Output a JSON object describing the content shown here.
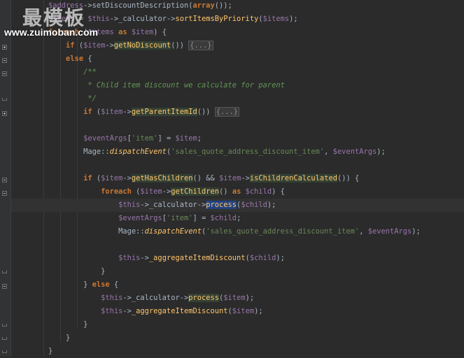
{
  "editor": {
    "lines": [
      [
        {
          "t": "    $",
          "c": "var"
        },
        {
          "t": "address",
          "c": "var"
        },
        {
          "t": "->setDiscountDescription("
        },
        {
          "t": "array",
          "c": "kw"
        },
        {
          "t": "());"
        }
      ],
      [
        {
          "t": "    $"
        },
        {
          "t": "items",
          "c": "var"
        },
        {
          "t": " = "
        },
        {
          "t": "$this",
          "c": "var"
        },
        {
          "t": "->_calculator->"
        },
        {
          "t": "sortItemsByPriority",
          "c": "fn"
        },
        {
          "t": "("
        },
        {
          "t": "$items",
          "c": "var"
        },
        {
          "t": ");"
        }
      ],
      [
        {
          "t": "    foreach ",
          "c": "kw"
        },
        {
          "t": "("
        },
        {
          "t": "$items",
          "c": "var"
        },
        {
          "t": " as ",
          "c": "kw"
        },
        {
          "t": "$item",
          "c": "var"
        },
        {
          "t": ") {"
        }
      ],
      [
        {
          "t": "        if ",
          "c": "kw"
        },
        {
          "t": "("
        },
        {
          "t": "$item",
          "c": "var"
        },
        {
          "t": "->"
        },
        {
          "t": "getNoDiscount",
          "c": "fn hl"
        },
        {
          "t": "()) "
        },
        {
          "t": "{...}",
          "c": "foldtag"
        }
      ],
      [
        {
          "t": "        else ",
          "c": "kw"
        },
        {
          "t": "{"
        }
      ],
      [
        {
          "t": "            /**",
          "c": "cmt"
        }
      ],
      [
        {
          "t": "             * Child item discount we calculate for parent",
          "c": "cmt"
        }
      ],
      [
        {
          "t": "             */",
          "c": "cmt"
        }
      ],
      [
        {
          "t": "            if ",
          "c": "kw"
        },
        {
          "t": "("
        },
        {
          "t": "$item",
          "c": "var"
        },
        {
          "t": "->"
        },
        {
          "t": "getParentItemId",
          "c": "fn hl"
        },
        {
          "t": "()) "
        },
        {
          "t": "{...}",
          "c": "foldtag"
        }
      ],
      [
        {
          "t": ""
        }
      ],
      [
        {
          "t": "            "
        },
        {
          "t": "$eventArgs",
          "c": "var"
        },
        {
          "t": "["
        },
        {
          "t": "'item'",
          "c": "str"
        },
        {
          "t": "] = "
        },
        {
          "t": "$item",
          "c": "var"
        },
        {
          "t": ";"
        }
      ],
      [
        {
          "t": "            Mage::"
        },
        {
          "t": "dispatchEvent",
          "c": "static"
        },
        {
          "t": "("
        },
        {
          "t": "'sales_quote_address_discount_item'",
          "c": "str"
        },
        {
          "t": ", "
        },
        {
          "t": "$eventArgs",
          "c": "var"
        },
        {
          "t": ");"
        }
      ],
      [
        {
          "t": ""
        }
      ],
      [
        {
          "t": "            if ",
          "c": "kw"
        },
        {
          "t": "("
        },
        {
          "t": "$item",
          "c": "var"
        },
        {
          "t": "->"
        },
        {
          "t": "getHasChildren",
          "c": "fn hl"
        },
        {
          "t": "() && "
        },
        {
          "t": "$item",
          "c": "var"
        },
        {
          "t": "->"
        },
        {
          "t": "isChildrenCalculated",
          "c": "fn hl"
        },
        {
          "t": "()) {"
        }
      ],
      [
        {
          "t": "                foreach ",
          "c": "kw"
        },
        {
          "t": "("
        },
        {
          "t": "$item",
          "c": "var"
        },
        {
          "t": "->"
        },
        {
          "t": "getChildren",
          "c": "fn hl"
        },
        {
          "t": "() "
        },
        {
          "t": "as ",
          "c": "kw"
        },
        {
          "t": "$child",
          "c": "var"
        },
        {
          "t": ") {"
        }
      ],
      [
        {
          "t": "                    "
        },
        {
          "t": "$this",
          "c": "var"
        },
        {
          "t": "->_calculator->"
        },
        {
          "t": "process",
          "c": "fn sel"
        },
        {
          "t": "("
        },
        {
          "t": "$child",
          "c": "var"
        },
        {
          "t": ");"
        }
      ],
      [
        {
          "t": "                    "
        },
        {
          "t": "$eventArgs",
          "c": "var"
        },
        {
          "t": "["
        },
        {
          "t": "'item'",
          "c": "str"
        },
        {
          "t": "] = "
        },
        {
          "t": "$child",
          "c": "var"
        },
        {
          "t": ";"
        }
      ],
      [
        {
          "t": "                    Mage::"
        },
        {
          "t": "dispatchEvent",
          "c": "static"
        },
        {
          "t": "("
        },
        {
          "t": "'sales_quote_address_discount_item'",
          "c": "str"
        },
        {
          "t": ", "
        },
        {
          "t": "$eventArgs",
          "c": "var"
        },
        {
          "t": ");"
        }
      ],
      [
        {
          "t": ""
        }
      ],
      [
        {
          "t": "                    "
        },
        {
          "t": "$this",
          "c": "var"
        },
        {
          "t": "->"
        },
        {
          "t": "_aggregateItemDiscount",
          "c": "fn"
        },
        {
          "t": "("
        },
        {
          "t": "$child",
          "c": "var"
        },
        {
          "t": ");"
        }
      ],
      [
        {
          "t": "                }"
        }
      ],
      [
        {
          "t": "            } "
        },
        {
          "t": "else ",
          "c": "kw"
        },
        {
          "t": "{"
        }
      ],
      [
        {
          "t": "                "
        },
        {
          "t": "$this",
          "c": "var"
        },
        {
          "t": "->_calculator->"
        },
        {
          "t": "process",
          "c": "fn hl"
        },
        {
          "t": "("
        },
        {
          "t": "$item",
          "c": "var"
        },
        {
          "t": ");"
        }
      ],
      [
        {
          "t": "                "
        },
        {
          "t": "$this",
          "c": "var"
        },
        {
          "t": "->"
        },
        {
          "t": "_aggregateItemDiscount",
          "c": "fn"
        },
        {
          "t": "("
        },
        {
          "t": "$item",
          "c": "var"
        },
        {
          "t": ");"
        }
      ],
      [
        {
          "t": "            }"
        }
      ],
      [
        {
          "t": "        }"
        }
      ],
      [
        {
          "t": "    }"
        }
      ]
    ]
  },
  "watermark": {
    "brand": "最模板",
    "url": "www.zuimoban.com"
  }
}
